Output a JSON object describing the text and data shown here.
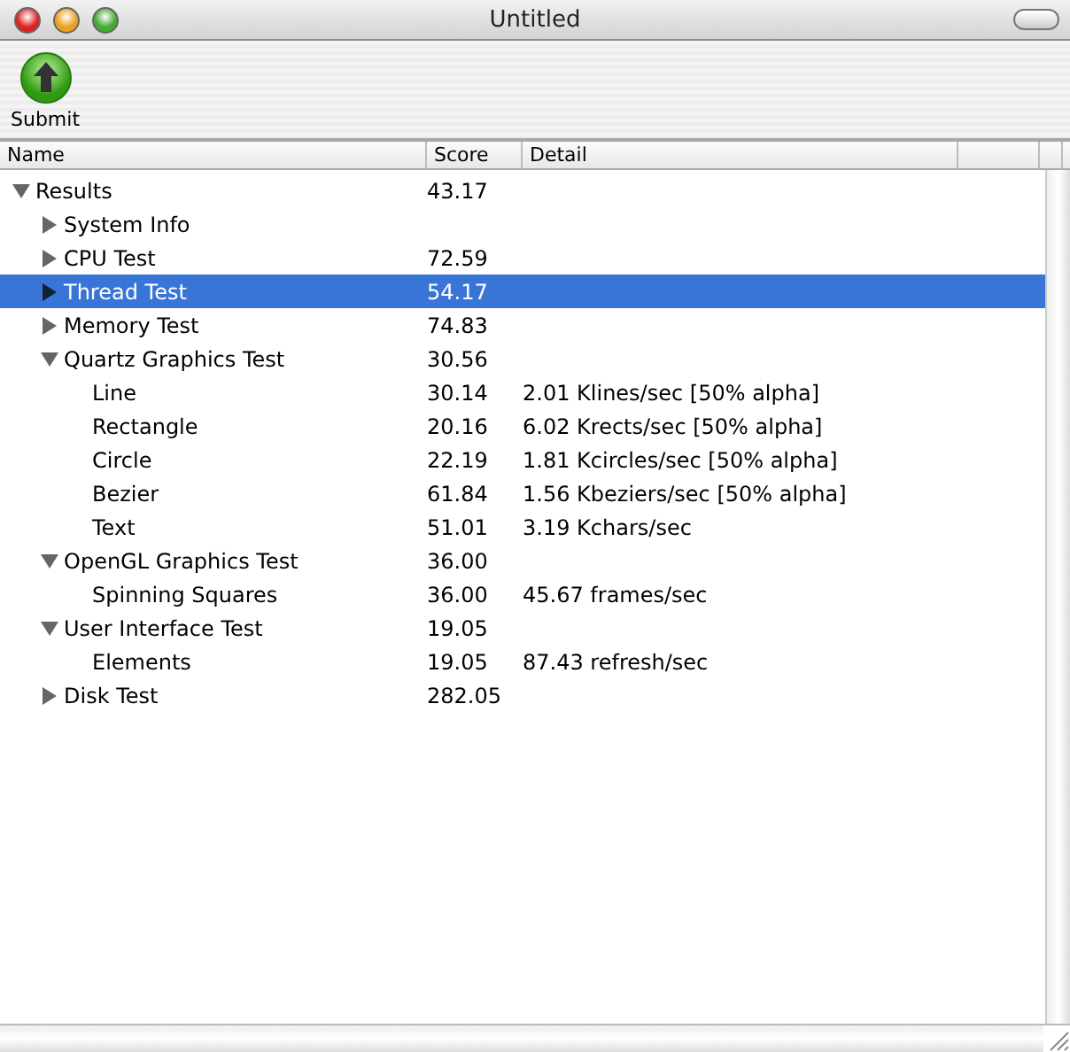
{
  "window": {
    "title": "Untitled"
  },
  "toolbar": [
    {
      "label": "Submit"
    }
  ],
  "table": {
    "columns": [
      "Name",
      "Score",
      "Detail"
    ],
    "rows": [
      {
        "name": "Results",
        "score": "43.17",
        "expanded": true,
        "selected": false,
        "children": [
          {
            "name": "System Info",
            "expanded": false,
            "selected": false
          },
          {
            "name": "CPU Test",
            "score": "72.59",
            "expanded": false,
            "selected": false
          },
          {
            "name": "Thread Test",
            "score": "54.17",
            "expanded": false,
            "selected": true
          },
          {
            "name": "Memory Test",
            "score": "74.83",
            "expanded": false,
            "selected": false
          },
          {
            "name": "Quartz Graphics Test",
            "score": "30.56",
            "expanded": true,
            "selected": false,
            "children": [
              {
                "name": "Line",
                "score": "30.14",
                "detail": "2.01 Klines/sec [50% alpha]",
                "selected": false
              },
              {
                "name": "Rectangle",
                "score": "20.16",
                "detail": "6.02 Krects/sec [50% alpha]",
                "selected": false
              },
              {
                "name": "Circle",
                "score": "22.19",
                "detail": "1.81 Kcircles/sec [50% alpha]",
                "selected": false
              },
              {
                "name": "Bezier",
                "score": "61.84",
                "detail": "1.56 Kbeziers/sec [50% alpha]",
                "selected": false
              },
              {
                "name": "Text",
                "score": "51.01",
                "detail": "3.19 Kchars/sec",
                "selected": false
              }
            ]
          },
          {
            "name": "OpenGL Graphics Test",
            "score": "36.00",
            "expanded": true,
            "selected": false,
            "children": [
              {
                "name": "Spinning Squares",
                "score": "36.00",
                "detail": "45.67 frames/sec",
                "selected": false
              }
            ]
          },
          {
            "name": "User Interface Test",
            "score": "19.05",
            "expanded": true,
            "selected": false,
            "children": [
              {
                "name": "Elements",
                "score": "19.05",
                "detail": "87.43 refresh/sec",
                "selected": false
              }
            ]
          },
          {
            "name": "Disk Test",
            "score": "282.05",
            "expanded": false,
            "selected": false
          }
        ]
      }
    ]
  }
}
